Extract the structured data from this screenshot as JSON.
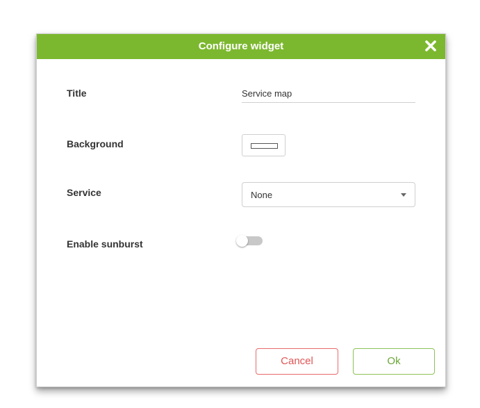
{
  "dialog": {
    "title": "Configure widget",
    "close_icon": "close-icon"
  },
  "fields": {
    "title_label": "Title",
    "title_value": "Service map",
    "background_label": "Background",
    "background_color": "#ffffff",
    "service_label": "Service",
    "service_value": "None",
    "sunburst_label": "Enable sunburst",
    "sunburst_enabled": false
  },
  "buttons": {
    "cancel_label": "Cancel",
    "ok_label": "Ok"
  },
  "colors": {
    "header": "#7cb82f",
    "cancel": "#e05555",
    "ok": "#6aa536"
  }
}
